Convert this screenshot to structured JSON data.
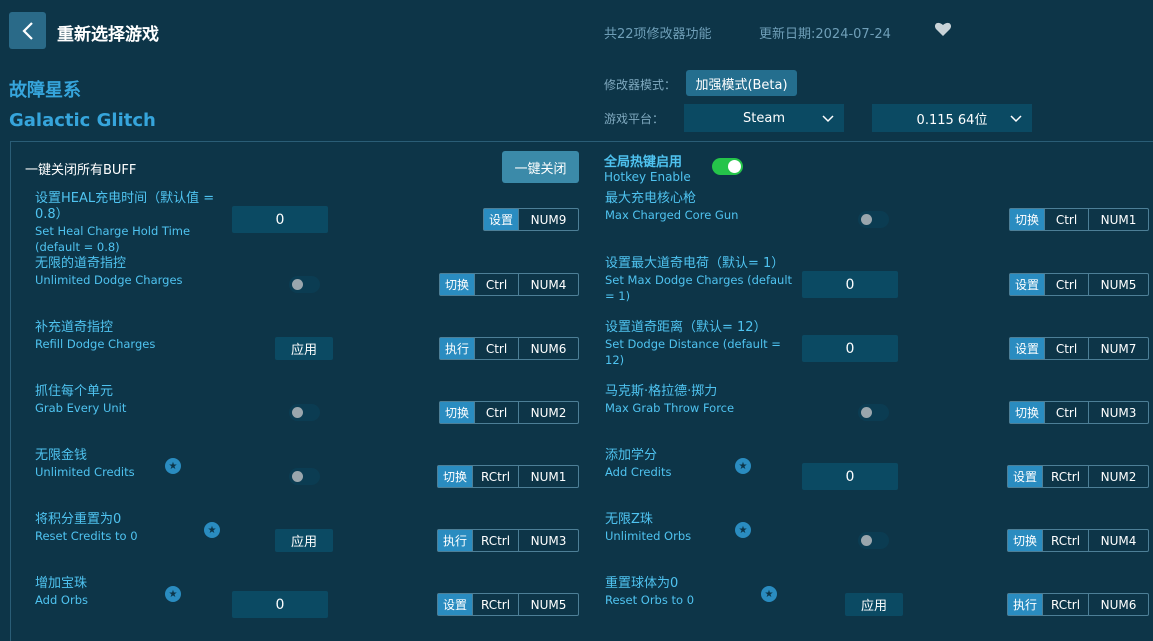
{
  "header": {
    "title": "重新选择游戏",
    "feature_count": "共22项修改器功能",
    "update_date": "更新日期:2024-07-24"
  },
  "game": {
    "name_cn": "故障星系",
    "name_en": "Galactic Glitch"
  },
  "settings": {
    "mode_label": "修改器模式：",
    "mode_value": "加强模式(Beta)",
    "platform_label": "游戏平台：",
    "platform_value": "Steam",
    "version_value": "0.115 64位"
  },
  "global": {
    "close_all_label": "一键关闭所有BUFF",
    "close_all_button": "一键关闭",
    "hotkey_cn": "全局热键启用",
    "hotkey_en": "Hotkey Enable"
  },
  "features_left": [
    {
      "cn": "设置HEAL充电时间（默认值 = 0.8）",
      "en": "Set Heal Charge Hold Time (default = 0.8)",
      "control": "input",
      "value": "0",
      "action": "设置",
      "keys": [
        "NUM9"
      ]
    },
    {
      "cn": "无限的道奇指控",
      "en": "Unlimited Dodge Charges",
      "control": "toggle",
      "action": "切换",
      "keys": [
        "Ctrl",
        "NUM4"
      ]
    },
    {
      "cn": "补充道奇指控",
      "en": "Refill Dodge Charges",
      "control": "apply",
      "apply_label": "应用",
      "action": "执行",
      "keys": [
        "Ctrl",
        "NUM6"
      ]
    },
    {
      "cn": "抓住每个单元",
      "en": "Grab Every Unit",
      "control": "toggle",
      "action": "切换",
      "keys": [
        "Ctrl",
        "NUM2"
      ]
    },
    {
      "cn": "无限金钱",
      "en": "Unlimited Credits",
      "control": "toggle",
      "star": true,
      "action": "切换",
      "keys": [
        "RCtrl",
        "NUM1"
      ]
    },
    {
      "cn": "将积分重置为0",
      "en": "Reset Credits to 0",
      "control": "apply",
      "apply_label": "应用",
      "star": true,
      "action": "执行",
      "keys": [
        "RCtrl",
        "NUM3"
      ]
    },
    {
      "cn": "增加宝珠",
      "en": "Add Orbs",
      "control": "input",
      "value": "0",
      "star": true,
      "action": "设置",
      "keys": [
        "RCtrl",
        "NUM5"
      ]
    }
  ],
  "features_right": [
    {
      "cn": "最大充电核心枪",
      "en": "Max Charged Core Gun",
      "control": "toggle",
      "action": "切换",
      "keys": [
        "Ctrl",
        "NUM1"
      ]
    },
    {
      "cn": "设置最大道奇电荷（默认= 1）",
      "en": "Set Max Dodge Charges (default = 1)",
      "control": "input",
      "value": "0",
      "action": "设置",
      "keys": [
        "Ctrl",
        "NUM5"
      ]
    },
    {
      "cn": "设置道奇距离（默认= 12）",
      "en": "Set Dodge Distance (default = 12)",
      "control": "input",
      "value": "0",
      "action": "设置",
      "keys": [
        "Ctrl",
        "NUM7"
      ]
    },
    {
      "cn": "马克斯·格拉德·掷力",
      "en": "Max Grab Throw Force",
      "control": "toggle",
      "action": "切换",
      "keys": [
        "Ctrl",
        "NUM3"
      ]
    },
    {
      "cn": "添加学分",
      "en": "Add Credits",
      "control": "input",
      "value": "0",
      "star": true,
      "action": "设置",
      "keys": [
        "RCtrl",
        "NUM2"
      ]
    },
    {
      "cn": "无限Z珠",
      "en": "Unlimited Orbs",
      "control": "toggle",
      "star": true,
      "action": "切换",
      "keys": [
        "RCtrl",
        "NUM4"
      ]
    },
    {
      "cn": "重置球体为0",
      "en": "Reset Orbs to 0",
      "control": "apply",
      "apply_label": "应用",
      "star": true,
      "action": "执行",
      "keys": [
        "RCtrl",
        "NUM6"
      ]
    }
  ]
}
